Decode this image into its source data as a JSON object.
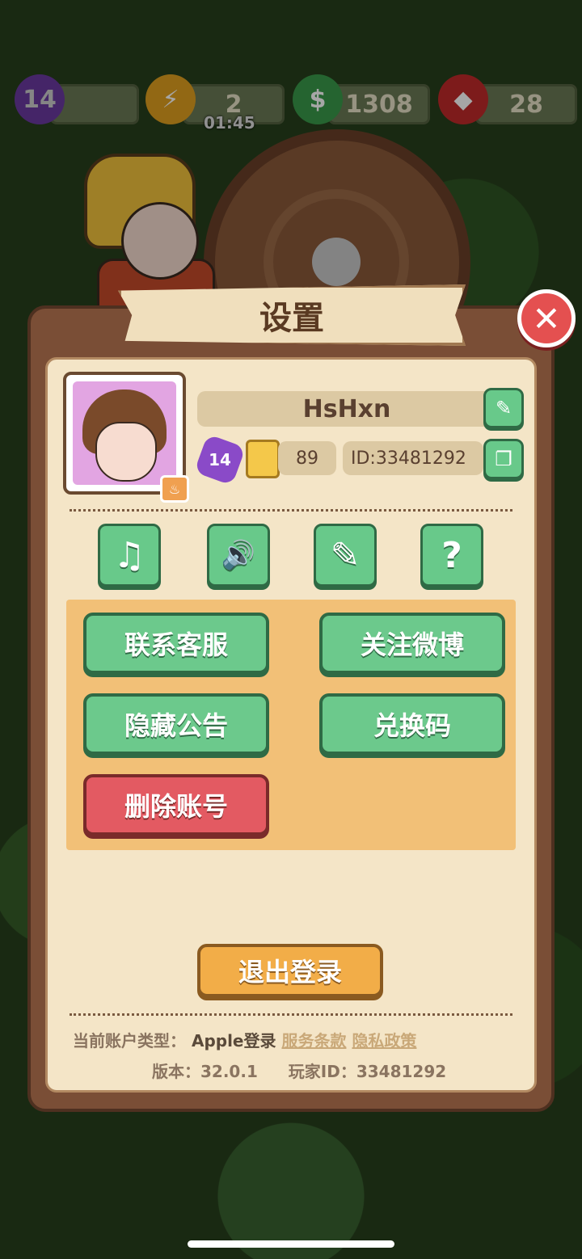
{
  "hud": {
    "level": "14",
    "energy": "2",
    "energy_timer": "01:45",
    "cash": "1308",
    "gems": "28"
  },
  "panel": {
    "title": "设置"
  },
  "profile": {
    "name": "HsHxn",
    "level": "14",
    "collection_count": "89",
    "id_label": "ID:33481292"
  },
  "icons": {
    "music": "♫",
    "sound": "🔊",
    "clean": "✎",
    "help": "?",
    "edit": "✎",
    "copy": "❐",
    "close": "✕",
    "avatar_badge": "♨"
  },
  "actions": {
    "contact_support": "联系客服",
    "follow_weibo": "关注微博",
    "hide_announcement": "隐藏公告",
    "redeem_code": "兑换码",
    "delete_account": "删除账号"
  },
  "logout_label": "退出登录",
  "footer": {
    "account_type_label": "当前账户类型：",
    "account_type_value": "Apple登录",
    "terms_link": "服务条款",
    "privacy_link": "隐私政策",
    "version_label": "版本：32.0.1",
    "player_id_label": "玩家ID：33481292"
  },
  "colors": {
    "button_green": "#6cc98c",
    "button_red": "#e35a62",
    "button_orange": "#f2ad48",
    "panel_brown": "#7a4e36",
    "panel_cream": "#f4e5c7"
  }
}
